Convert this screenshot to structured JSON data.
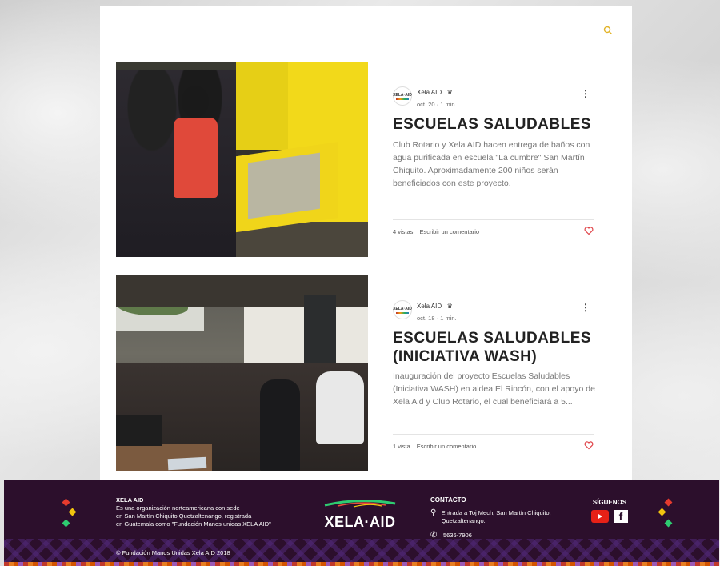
{
  "posts": [
    {
      "author": "Xela AID",
      "avatar_text": "XELA·AID",
      "date": "oct. 20",
      "read_time": "1 min.",
      "title": "ESCUELAS SALUDABLES",
      "excerpt": "Club Rotario y Xela AID hacen entrega de baños con agua purificada en escuela \"La cumbre\" San Martín Chiquito. Aproximadamente 200 niños serán beneficiados con este proyecto.",
      "views": "4 vistas",
      "comment_link": "Escribir un comentario"
    },
    {
      "author": "Xela AID",
      "avatar_text": "XELA·AID",
      "date": "oct. 18",
      "read_time": "1 min.",
      "title": "ESCUELAS SALUDABLES (INICIATIVA WASH)",
      "excerpt": "Inauguración del proyecto Escuelas Saludables (Iniciativa WASH) en aldea El Rincón, con el apoyo de Xela Aid y Club Rotario, el cual beneficiará a 5...",
      "views": "1 vista",
      "comment_link": "Escribir un comentario"
    }
  ],
  "footer": {
    "about_title": "XELA AID",
    "about_lines": [
      "Es una organización norteamericana con sede",
      "en San Martín Chiquito Quetzaltenango, registrada",
      "en Guatemala como \"Fundación Manos unidas XELA AID\""
    ],
    "logo_text": "XELA·AID",
    "contact_title": "CONTACTO",
    "address": "Entrada a Toj Mech, San Martín Chiquito, Quetzaltenango.",
    "phone": "5636-7906",
    "social_title": "SÍGUENOS",
    "copyright": "© Fundación Manos Unidas Xela AID  2018"
  },
  "icons": {
    "search": "search-icon",
    "more": "more-options-icon",
    "heart": "heart-icon",
    "crown": "crown-icon",
    "location": "location-pin-icon",
    "phone": "phone-icon",
    "youtube": "youtube-icon",
    "facebook": "facebook-icon"
  },
  "colors": {
    "accent": "#e2b42a",
    "heart": "#e0454a",
    "footer_bg": "#2c0f2c"
  }
}
